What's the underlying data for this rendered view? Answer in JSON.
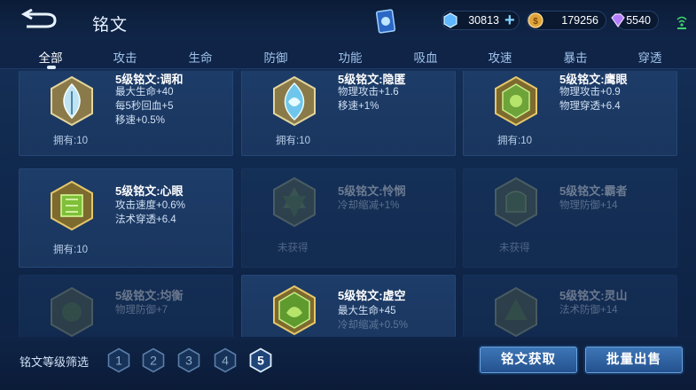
{
  "header": {
    "title": "铭文"
  },
  "currencies": [
    {
      "icon": "diamond-icon",
      "value": "30813"
    },
    {
      "icon": "gold-coin-icon",
      "value": "179256"
    },
    {
      "icon": "gem-icon",
      "value": "5540"
    }
  ],
  "tabs": [
    "全部",
    "攻击",
    "生命",
    "防御",
    "功能",
    "吸血",
    "攻速",
    "暴击",
    "穿透"
  ],
  "active_tab": "全部",
  "inscriptions": [
    {
      "name": "5级铭文:调和",
      "stats": [
        "最大生命+40",
        "每5秒回血+5",
        "移速+0.5%"
      ],
      "owned": "拥有:10",
      "color": "blue"
    },
    {
      "name": "5级铭文:隐匿",
      "stats": [
        "物理攻击+1.6",
        "移速+1%"
      ],
      "owned": "拥有:10",
      "color": "blue"
    },
    {
      "name": "5级铭文:鹰眼",
      "stats": [
        "物理攻击+0.9",
        "物理穿透+6.4"
      ],
      "owned": "拥有:10",
      "color": "green"
    },
    {
      "name": "5级铭文:心眼",
      "stats": [
        "攻击速度+0.6%",
        "法术穿透+6.4"
      ],
      "owned": "拥有:10",
      "color": "green"
    },
    {
      "name": "5级铭文:怜悯",
      "stats": [
        "冷却缩减+1%"
      ],
      "owned": "未获得",
      "color": "green"
    },
    {
      "name": "5级铭文:霸者",
      "stats": [
        "物理防御+14"
      ],
      "owned": "未获得",
      "color": "green"
    },
    {
      "name": "5级铭文:均衡",
      "stats": [
        "物理防御+7"
      ],
      "owned": "",
      "color": "green"
    },
    {
      "name": "5级铭文:虚空",
      "stats": [
        "最大生命+45",
        "冷却缩减+0.5%"
      ],
      "owned": "",
      "color": "green"
    },
    {
      "name": "5级铭文:灵山",
      "stats": [
        "法术防御+14"
      ],
      "owned": "",
      "color": "green"
    }
  ],
  "filter": {
    "label": "铭文等级筛选",
    "levels": [
      "1",
      "2",
      "3",
      "4",
      "5"
    ],
    "selected": "5"
  },
  "buttons": {
    "obtain": "铭文获取",
    "sell": "批量出售"
  }
}
